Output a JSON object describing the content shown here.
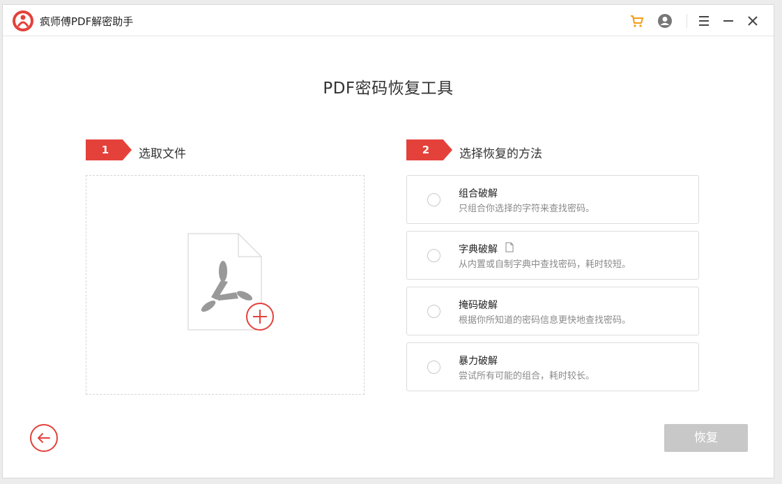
{
  "app": {
    "title": "疯师傅PDF解密助手"
  },
  "header": {
    "title": "PDF密码恢复工具"
  },
  "steps": [
    {
      "number": "1",
      "label": "选取文件"
    },
    {
      "number": "2",
      "label": "选择恢复的方法"
    }
  ],
  "methods": [
    {
      "title": "组合破解",
      "desc": "只组合你选择的字符来查找密码。"
    },
    {
      "title": "字典破解",
      "desc": "从内置或自制字典中查找密码，耗时较短。"
    },
    {
      "title": "掩码破解",
      "desc": "根据你所知道的密码信息更快地查找密码。"
    },
    {
      "title": "暴力破解",
      "desc": "尝试所有可能的组合，耗时较长。"
    }
  ],
  "footer": {
    "recover_label": "恢复"
  },
  "icons": {
    "logo": "app-logo-icon",
    "cart": "cart-icon",
    "account": "user-icon",
    "menu": "menu-icon",
    "minimize": "minimize-icon",
    "close": "close-icon",
    "back": "arrow-left-icon",
    "file_add": "pdf-file-add-icon",
    "dict_file": "file-icon"
  },
  "colors": {
    "accent": "#e4413b",
    "cart": "#f39c12",
    "disabled_button": "#c8c8c8"
  }
}
